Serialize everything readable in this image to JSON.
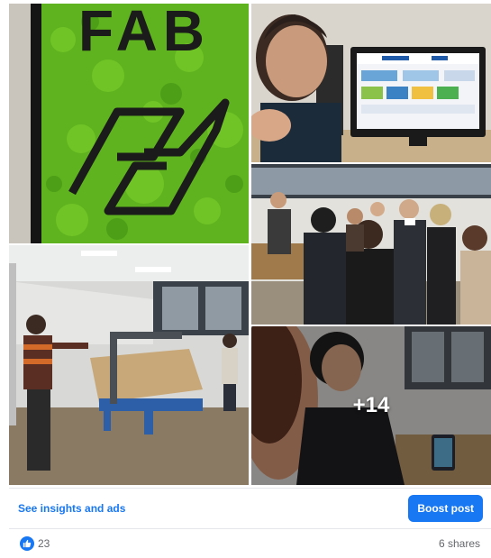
{
  "photos": {
    "fab_sign": {
      "letters": "FAB"
    },
    "more_count": "+14"
  },
  "actions": {
    "insights_label": "See insights and ads",
    "boost_label": "Boost post"
  },
  "stats": {
    "reaction_count": "23",
    "shares_label": "6 shares"
  },
  "colors": {
    "accent": "#1877f2",
    "moss": "#5fb31e",
    "muted_text": "#65676b"
  }
}
